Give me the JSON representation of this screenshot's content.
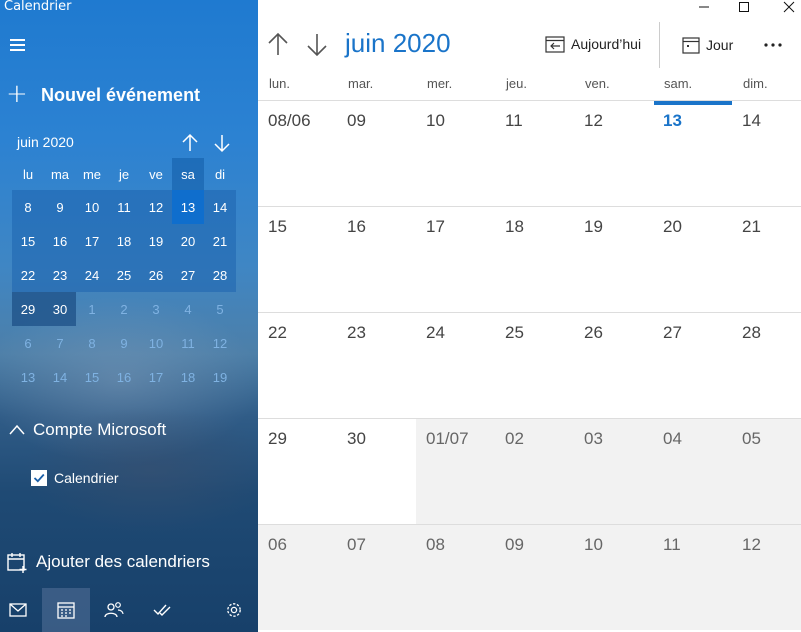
{
  "app": {
    "title": "Calendrier"
  },
  "sidebar": {
    "new_event_label": "Nouvel événement",
    "mini_calendar": {
      "month_label": "juin 2020",
      "weekday_headers": [
        "lu",
        "ma",
        "me",
        "je",
        "ve",
        "sa",
        "di"
      ],
      "weeks": [
        [
          "8",
          "9",
          "10",
          "11",
          "12",
          "13",
          "14"
        ],
        [
          "15",
          "16",
          "17",
          "18",
          "19",
          "20",
          "21"
        ],
        [
          "22",
          "23",
          "24",
          "25",
          "26",
          "27",
          "28"
        ],
        [
          "29",
          "30",
          "1",
          "2",
          "3",
          "4",
          "5"
        ],
        [
          "6",
          "7",
          "8",
          "9",
          "10",
          "11",
          "12"
        ],
        [
          "13",
          "14",
          "15",
          "16",
          "17",
          "18",
          "19"
        ]
      ],
      "selected_day": "13"
    },
    "account_label": "Compte Microsoft",
    "calendar_item_label": "Calendrier",
    "calendar_item_checked": true,
    "add_calendars_label": "Ajouter des calendriers",
    "bottom_nav": [
      "mail-icon",
      "calendar-icon",
      "people-icon",
      "todo-icon",
      "settings-icon"
    ],
    "active_nav": "calendar-icon"
  },
  "toolbar": {
    "month_title": "juin 2020",
    "today_label": "Aujourd’hui",
    "view_label": "Jour",
    "more_label": "..."
  },
  "month_view": {
    "weekdays": [
      "lun.",
      "mar.",
      "mer.",
      "jeu.",
      "ven.",
      "sam.",
      "dim."
    ],
    "weeks": [
      [
        "08/06",
        "09",
        "10",
        "11",
        "12",
        "13",
        "14"
      ],
      [
        "15",
        "16",
        "17",
        "18",
        "19",
        "20",
        "21"
      ],
      [
        "22",
        "23",
        "24",
        "25",
        "26",
        "27",
        "28"
      ],
      [
        "29",
        "30",
        "01/07",
        "02",
        "03",
        "04",
        "05"
      ],
      [
        "06",
        "07",
        "08",
        "09",
        "10",
        "11",
        "12"
      ]
    ],
    "today": "13"
  },
  "colors": {
    "accent": "#1a74c9",
    "sidebar_top": "#1f7ad0",
    "sidebar_bottom": "#17406a",
    "other_month_bg": "#f2f2f2"
  }
}
